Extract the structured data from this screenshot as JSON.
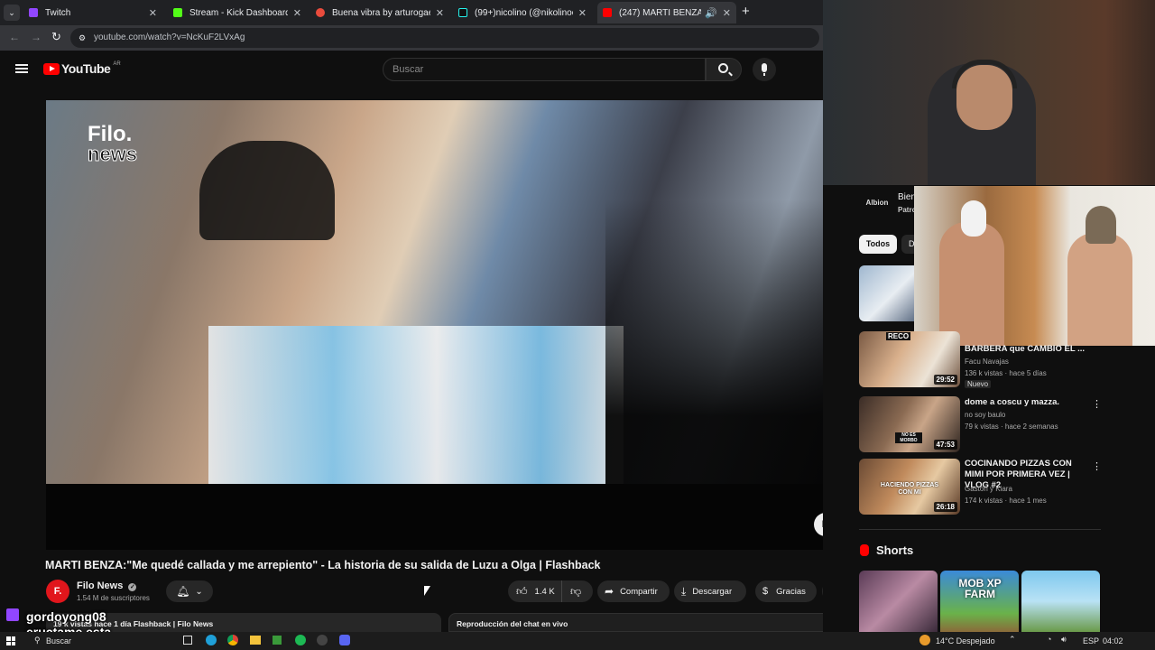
{
  "browser": {
    "tabs": [
      {
        "label": "Twitch",
        "color": "#9146ff"
      },
      {
        "label": "Stream - Kick Dashboard",
        "color": "#53fc18"
      },
      {
        "label": "Buena vibra by arturogaeldeleo",
        "color": "#e94b3c"
      },
      {
        "label": "(99+)nicolino (@nikolinoo) | Tik",
        "color": "#25f4ee"
      },
      {
        "label": "(247) MARTI BENZA:\"Me qu",
        "color": "#ff0000"
      }
    ],
    "url": "youtube.com/watch?v=NcKuF2LVxAg"
  },
  "youtube": {
    "logo": "YouTube",
    "region": "AR",
    "search_placeholder": "Buscar"
  },
  "video": {
    "watermark_line1": "Filo.",
    "watermark_line2": "news",
    "corner_badge": "F.",
    "title": "MARTI BENZA:\"Me quedé callada y me arrepiento\" - La historia de su salida de Luzu a Olga | Flashback",
    "channel": "Filo News",
    "channel_avatar": "F.",
    "subscribers": "1.54 M de suscriptores",
    "likes": "1.4 K",
    "share": "Compartir",
    "download": "Descargar",
    "thanks": "Gracias",
    "views_meta": "19 k vistas  hace 1 día  Flashback | Filo News",
    "chat_replay": "Reproducción del chat en vivo"
  },
  "overlay": {
    "twitch_user": "gordoyong08",
    "twitch_msg": "eructame esta"
  },
  "sidebar": {
    "sponsor_title": "Bien",
    "sponsor_sub": "Patro",
    "sponsor_logo": "Albion",
    "chips": [
      "Todos",
      "D"
    ],
    "recs": [
      {
        "title": "BARBERA que CAMBIO EL ...",
        "channel": "Facu Navajas",
        "meta": "136 k vistas · hace 5 días",
        "badge": "Nuevo",
        "duration": "29:52",
        "thumb_label": "RECO"
      },
      {
        "title": "dome a coscu y mazza.",
        "channel": "no soy baulo",
        "meta": "79 k vistas · hace 2 semanas",
        "duration": "47:53",
        "thumb_label": "NO ES MORBO"
      },
      {
        "title": "COCINANDO PIZZAS CON MIMI POR PRIMERA VEZ | VLOG #2",
        "channel": "Gaston y Kiara",
        "meta": "174 k vistas · hace 1 mes",
        "duration": "26:18",
        "thumb_label": "HACIENDO PIZZAS CON MI"
      }
    ],
    "shorts_label": "Shorts",
    "short_thumb_text": "MOB XP FARM"
  },
  "taskbar": {
    "search": "Buscar",
    "weather": "14°C  Despejado",
    "lang": "ESP",
    "time": "04:02"
  }
}
